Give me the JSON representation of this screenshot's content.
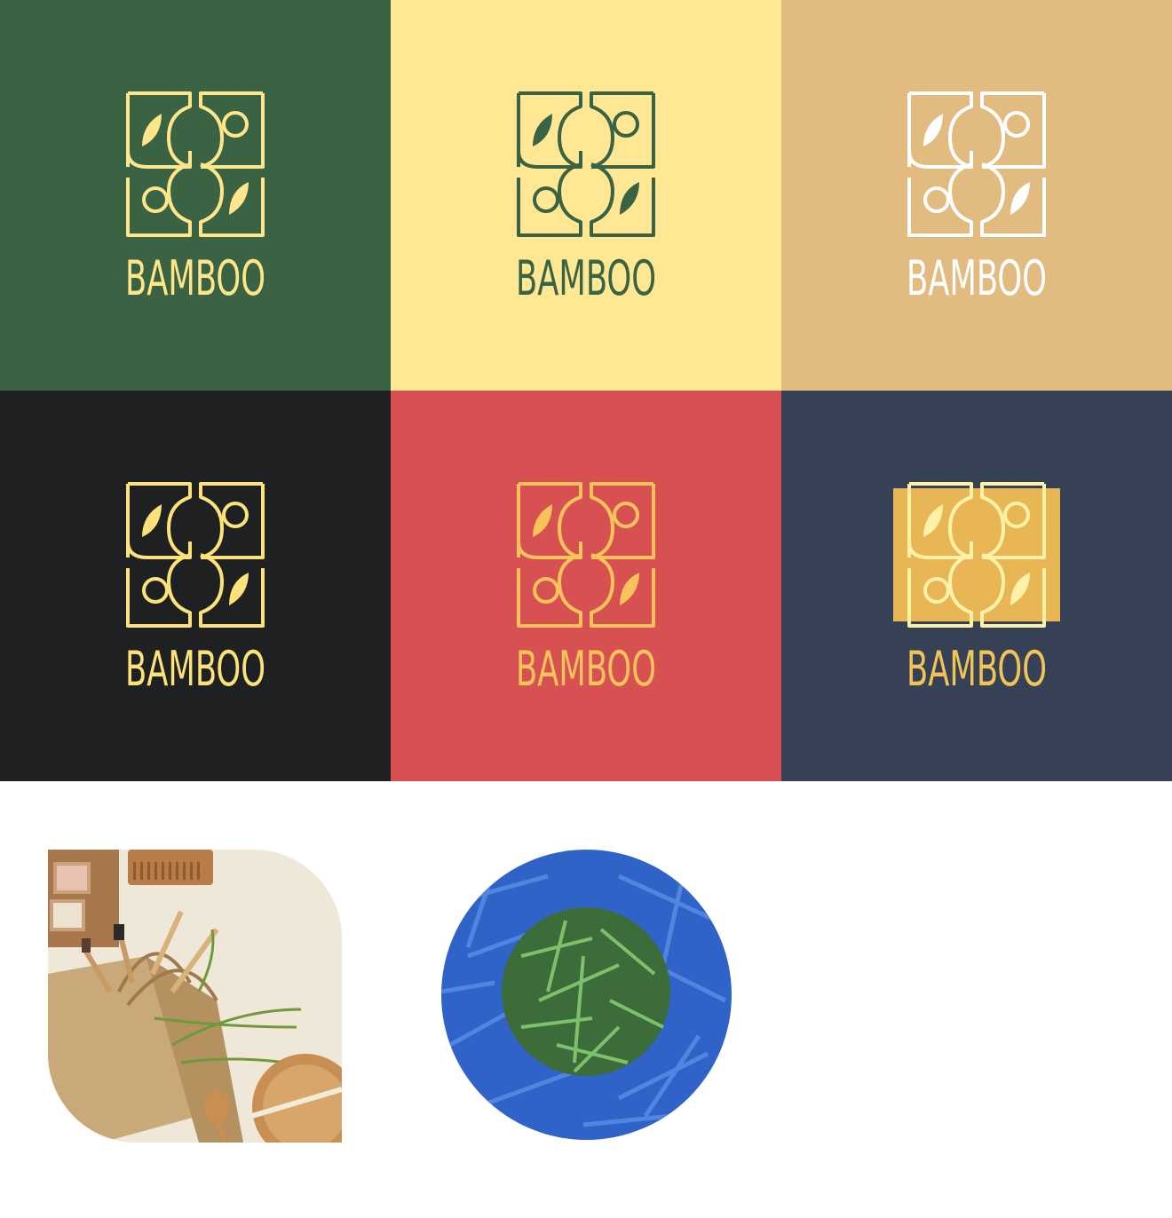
{
  "brand": {
    "wordmark": "BAMBOO"
  },
  "tiles": [
    {
      "bg": "#3a6344",
      "fg": "#ffe68a",
      "badge": false
    },
    {
      "bg": "#ffe793",
      "fg": "#3a6344",
      "badge": false
    },
    {
      "bg": "#e1bb7f",
      "fg": "#ffffff",
      "badge": false
    },
    {
      "bg": "#1f2021",
      "fg": "#fde27a",
      "badge": false
    },
    {
      "bg": "#d85152",
      "fg": "#f7c35a",
      "badge": false
    },
    {
      "bg": "#374156",
      "fg": "#f2c457",
      "badge": true,
      "badgeFill": "#e9b656",
      "badgeInner": "#fff1a8"
    }
  ],
  "icons": {
    "logo": "bamboo-leaf-circle-logo-icon",
    "photo": "eco-products-photo",
    "circle": "bamboo-leaves-circle-photo"
  }
}
